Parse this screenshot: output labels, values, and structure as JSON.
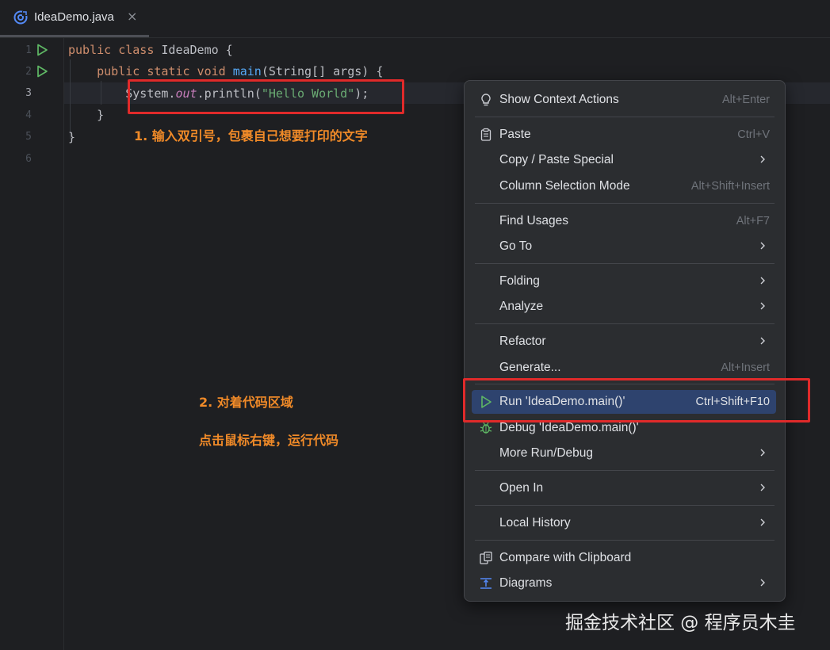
{
  "tab": {
    "filename": "IdeaDemo.java",
    "close": "×"
  },
  "editor": {
    "line_numbers": [
      "1",
      "2",
      "3",
      "4",
      "5",
      "6"
    ],
    "active_line": "3"
  },
  "annotations": {
    "note1": "1. 输入双引号，包裹自己想要打印的文字",
    "note2": "2. 对着代码区域",
    "note3": "点击鼠标右键，运行代码"
  },
  "menu": {
    "items": [
      {
        "label": "Show Context Actions",
        "shortcut": "Alt+Enter",
        "icon": "lightbulb-icon"
      },
      {
        "label": "Paste",
        "shortcut": "Ctrl+V",
        "icon": "clipboard-icon"
      },
      {
        "label": "Copy / Paste Special",
        "shortcut": "",
        "submenu": true
      },
      {
        "label": "Column Selection Mode",
        "shortcut": "Alt+Shift+Insert"
      },
      {
        "label": "Find Usages",
        "shortcut": "Alt+F7"
      },
      {
        "label": "Go To",
        "shortcut": "",
        "submenu": true
      },
      {
        "label": "Folding",
        "shortcut": "",
        "submenu": true
      },
      {
        "label": "Analyze",
        "shortcut": "",
        "submenu": true
      },
      {
        "label": "Refactor",
        "shortcut": "",
        "submenu": true
      },
      {
        "label": "Generate...",
        "shortcut": "Alt+Insert"
      },
      {
        "label": "Run 'IdeaDemo.main()'",
        "shortcut": "Ctrl+Shift+F10",
        "icon": "run-icon",
        "selected": true
      },
      {
        "label": "Debug 'IdeaDemo.main()'",
        "shortcut": "",
        "icon": "debug-icon"
      },
      {
        "label": "More Run/Debug",
        "shortcut": "",
        "submenu": true
      },
      {
        "label": "Open In",
        "shortcut": "",
        "submenu": true
      },
      {
        "label": "Local History",
        "shortcut": "",
        "submenu": true
      },
      {
        "label": "Compare with Clipboard",
        "shortcut": "",
        "icon": "compare-icon"
      },
      {
        "label": "Diagrams",
        "shortcut": "",
        "icon": "diagram-icon",
        "submenu": true
      }
    ]
  },
  "watermark": "掘金技术社区 @ 程序员木圭",
  "colors": {
    "highlight_box": "#e02a2a",
    "annotation": "#f08a28",
    "selected_item": "#2e436e",
    "run_green": "#5fb865"
  }
}
